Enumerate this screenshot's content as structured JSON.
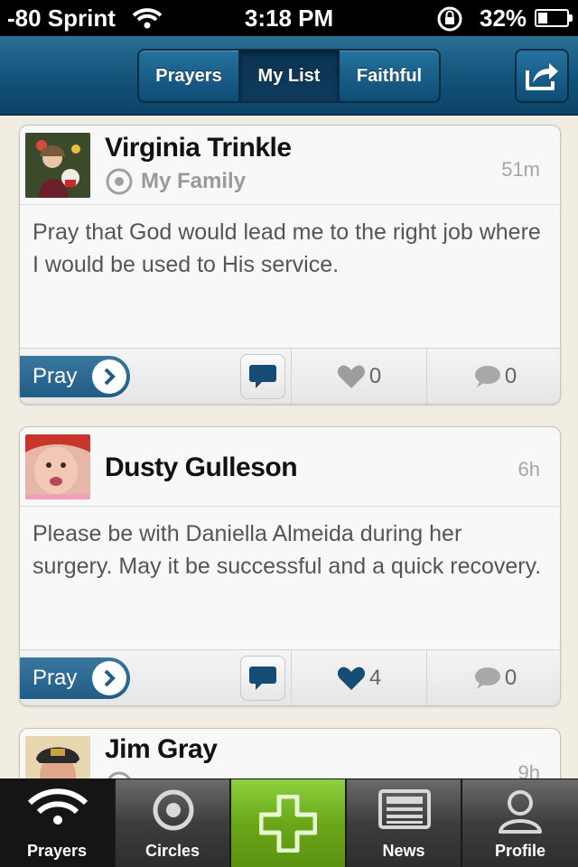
{
  "status_bar": {
    "carrier": "-80 Sprint",
    "time": "3:18 PM",
    "battery": "32%",
    "battery_level": 0.32
  },
  "nav": {
    "tabs": [
      "Prayers",
      "My List",
      "Faithful"
    ],
    "active_tab": "My List"
  },
  "posts": [
    {
      "author": "Virginia Trinkle",
      "circle": "My Family",
      "time": "51m",
      "text": "Pray that God would lead me to the right job where I would be used to His service.",
      "pray_label": "Pray",
      "likes": "0",
      "comments": "0",
      "liked": false
    },
    {
      "author": "Dusty Gulleson",
      "circle": "",
      "time": "6h",
      "text": "Please be with Daniella Almeida during her surgery. May it be successful and a quick recovery.",
      "pray_label": "Pray",
      "likes": "4",
      "comments": "0",
      "liked": true
    },
    {
      "author": "Jim Gray",
      "circle": "",
      "time": "9h"
    }
  ],
  "tabbar": {
    "items": [
      "Prayers",
      "Circles",
      "",
      "News",
      "Profile"
    ],
    "selected": "Prayers"
  },
  "colors": {
    "nav_blue": "#14557c",
    "pray_blue": "#1f5d86",
    "add_green": "#69a718",
    "background": "#f1ede2"
  }
}
